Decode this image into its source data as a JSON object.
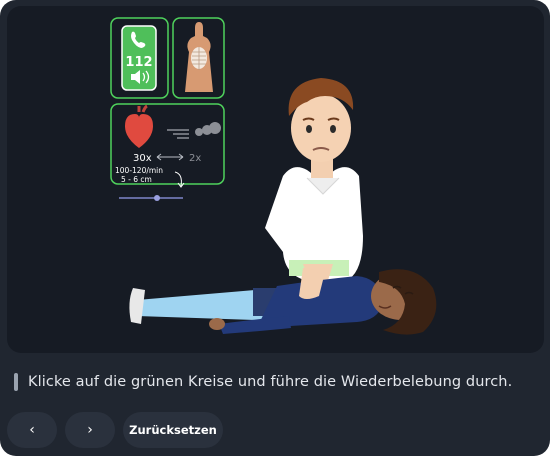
{
  "scene": {
    "phone_number": "112",
    "compressions": "30x",
    "breaths": "2x",
    "rate": "100-120/min",
    "depth": "5 - 6 cm",
    "icons": [
      "phone-icon",
      "speaker-icon",
      "torso-skeleton-icon",
      "heart-icon",
      "breath-icon"
    ],
    "colors": {
      "panel_border": "#4fd25c",
      "phone_green": "#4fbf5a",
      "stage_bg": "#161b24",
      "app_bg": "#202630"
    }
  },
  "instruction": {
    "text": "Klicke auf die grünen Kreise und führe die Wiederbelebung durch."
  },
  "controls": {
    "prev_label": "‹",
    "next_label": "›",
    "reset_label": "Zurücksetzen"
  }
}
